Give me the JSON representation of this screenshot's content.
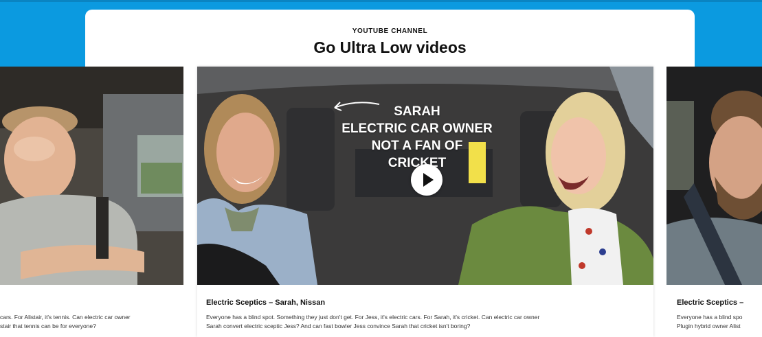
{
  "section": {
    "kicker": "YOUTUBE CHANNEL",
    "title": "Go Ultra Low videos"
  },
  "videos": [
    {
      "title": "",
      "description_line1": "cars. For Alistair, it's tennis. Can electric car owner",
      "description_line2": "stair that tennis can be for everyone?"
    },
    {
      "title": "Electric Sceptics – Sarah, Nissan",
      "overlay_line1": "SARAH",
      "overlay_line2": "ELECTRIC CAR OWNER",
      "overlay_line3": "NOT A FAN OF",
      "overlay_line4": "CRICKET",
      "description_line1": "Everyone has a blind spot. Something they just don't get. For Jess, it's electric cars. For Sarah, it's cricket. Can electric car owner",
      "description_line2": "Sarah convert electric sceptic Jess? And can fast bowler Jess convince Sarah that cricket isn't boring?"
    },
    {
      "title": "Electric Sceptics –",
      "description_line1": "Everyone has a blind spo",
      "description_line2": "Plugin hybrid owner Alist"
    }
  ],
  "colors": {
    "brand_blue": "#0b9ae0",
    "play_button": "#ffffff"
  },
  "icons": {
    "play": "play-icon",
    "arrow": "curved-arrow-icon"
  }
}
